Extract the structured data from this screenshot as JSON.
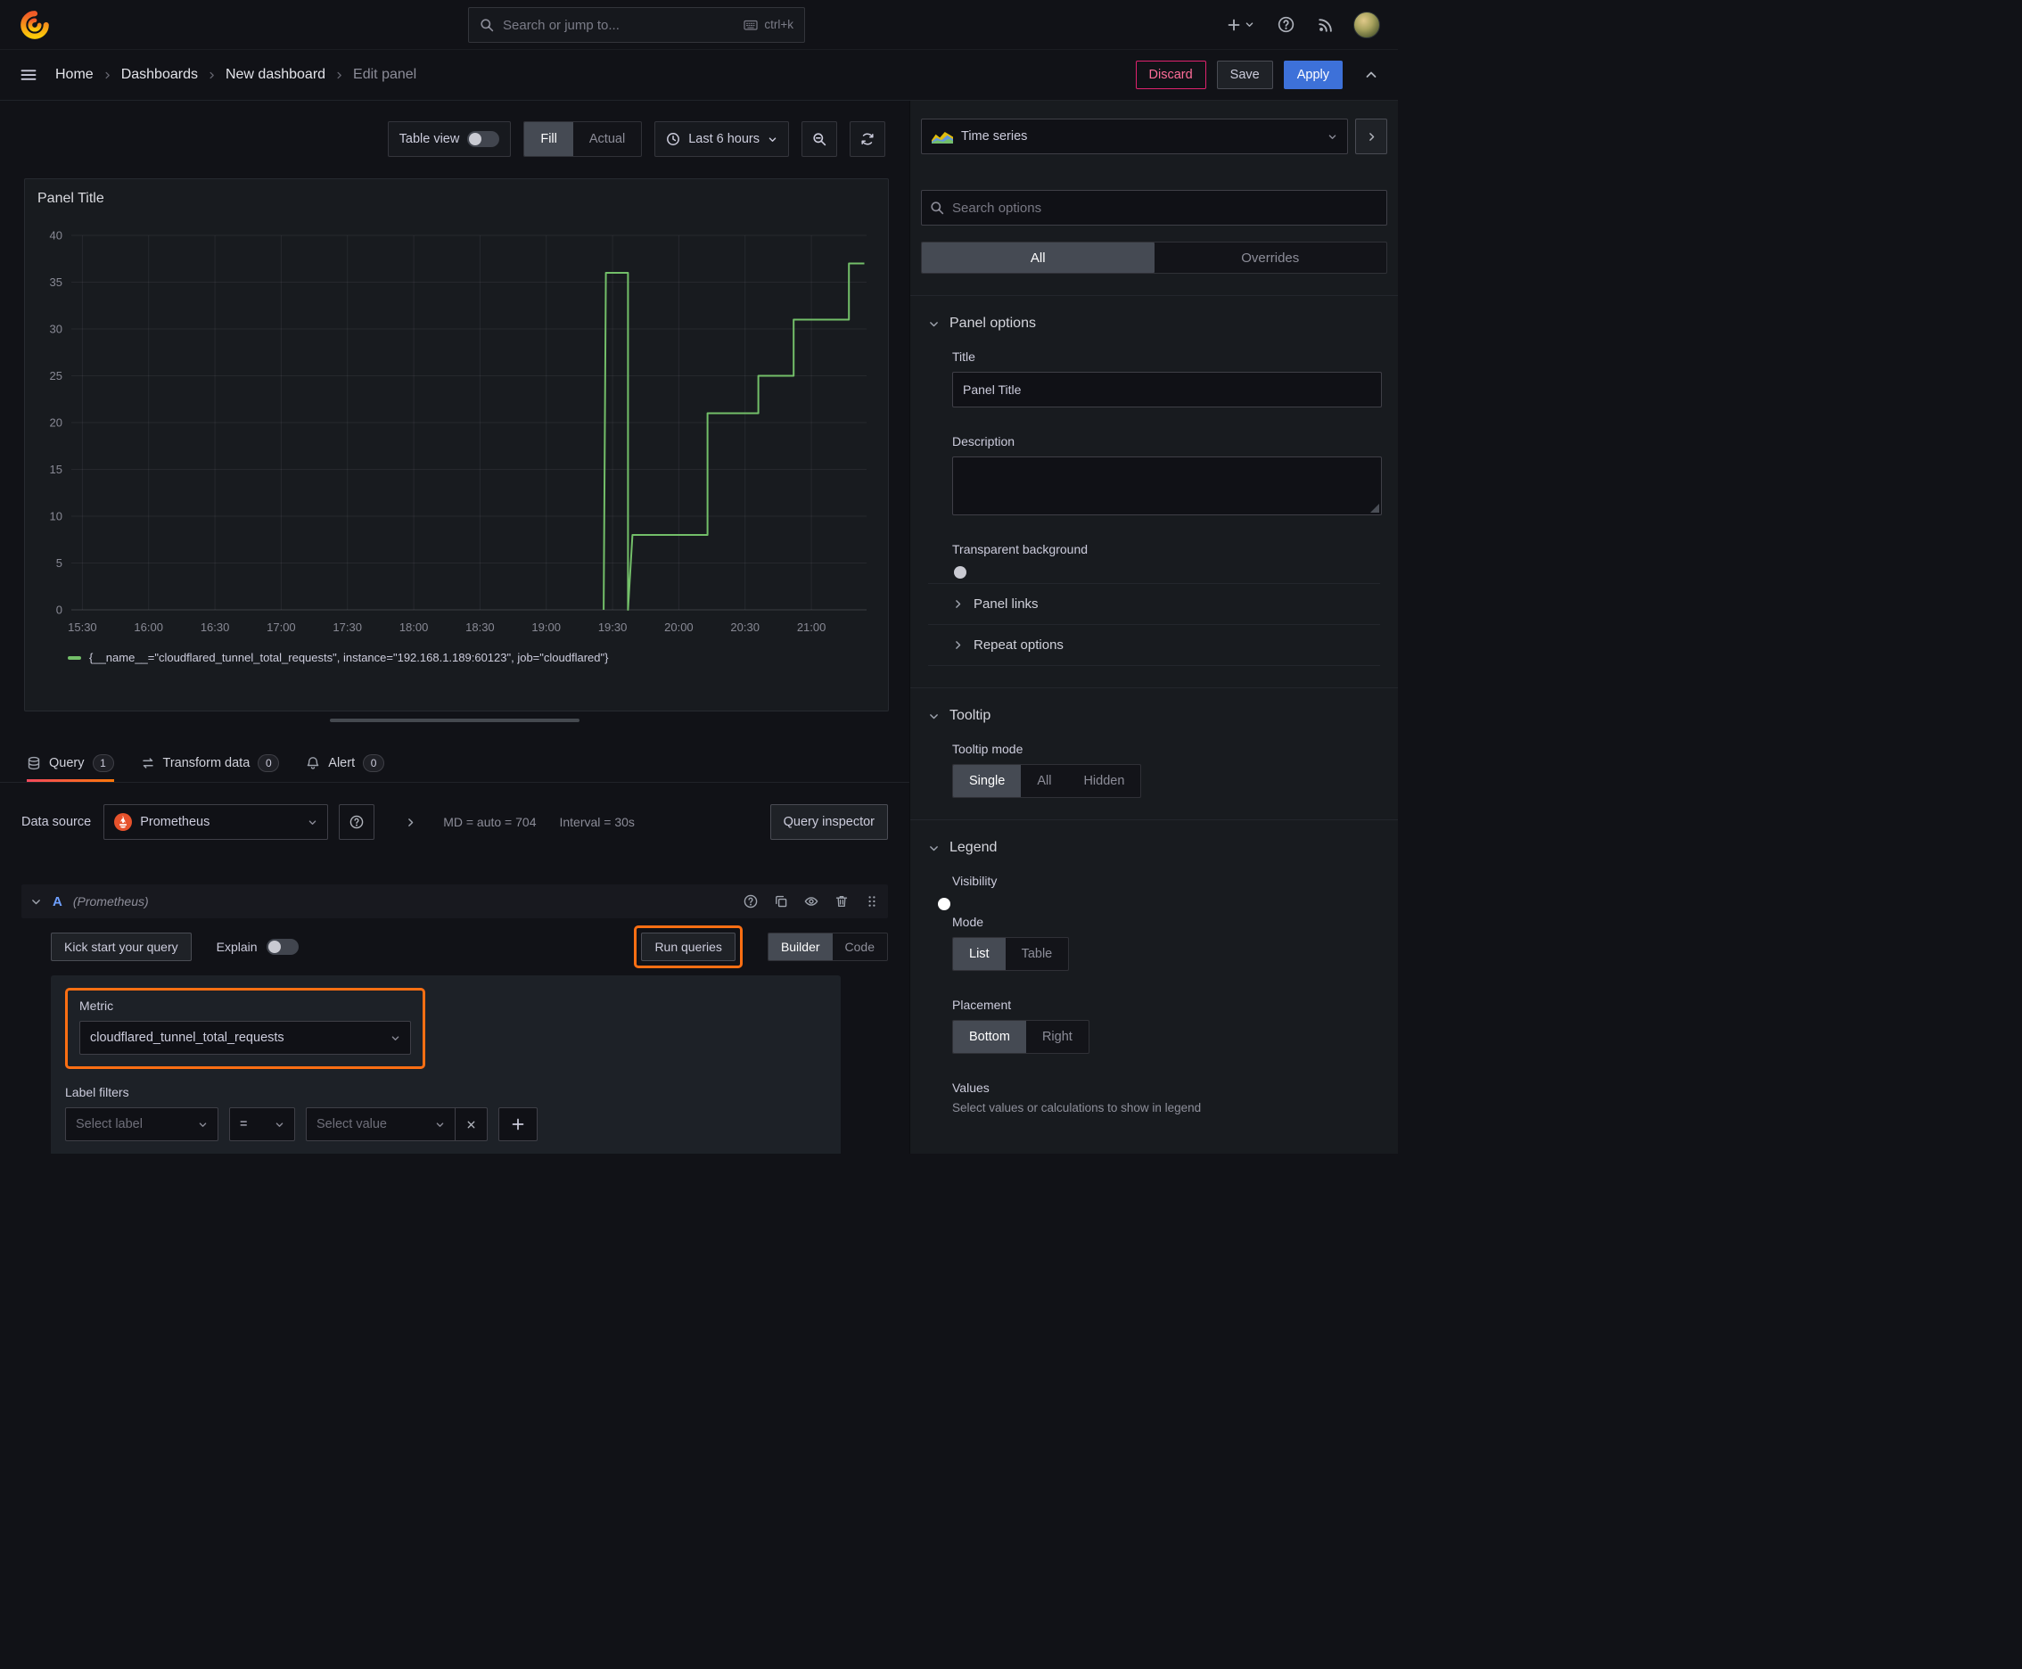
{
  "topnav": {
    "search_placeholder": "Search or jump to...",
    "search_shortcut": "ctrl+k"
  },
  "breadcrumbs": {
    "items": [
      "Home",
      "Dashboards",
      "New dashboard",
      "Edit panel"
    ]
  },
  "actions": {
    "discard": "Discard",
    "save": "Save",
    "apply": "Apply"
  },
  "toolbar": {
    "table_view": "Table view",
    "fill": "Fill",
    "actual": "Actual",
    "time_range": "Last 6 hours"
  },
  "panel": {
    "title": "Panel Title"
  },
  "chart_data": {
    "type": "line",
    "line_style": "step",
    "color": "#73bf69",
    "title": "Panel Title",
    "grid": true,
    "legend_position": "bottom",
    "x_domain": [
      "15:25",
      "21:25"
    ],
    "x_ticks": [
      "15:30",
      "16:00",
      "16:30",
      "17:00",
      "17:30",
      "18:00",
      "18:30",
      "19:00",
      "19:30",
      "20:00",
      "20:30",
      "21:00"
    ],
    "y_ticks": [
      0,
      5,
      10,
      15,
      20,
      25,
      30,
      35,
      40
    ],
    "ylim": [
      0,
      40
    ],
    "series": [
      {
        "name": "{__name__=\"cloudflared_tunnel_total_requests\", instance=\"192.168.1.189:60123\", job=\"cloudflared\"}",
        "points": [
          [
            "19:26",
            0
          ],
          [
            "19:27",
            36
          ],
          [
            "19:37",
            36
          ],
          [
            "19:37",
            0
          ],
          [
            "19:39",
            8
          ],
          [
            "20:13",
            8
          ],
          [
            "20:13",
            21
          ],
          [
            "20:36",
            21
          ],
          [
            "20:36",
            25
          ],
          [
            "20:52",
            25
          ],
          [
            "20:52",
            31
          ],
          [
            "21:17",
            31
          ],
          [
            "21:17",
            37
          ],
          [
            "21:24",
            37
          ]
        ]
      }
    ]
  },
  "tabs": {
    "query": {
      "label": "Query",
      "count": "1"
    },
    "transform": {
      "label": "Transform data",
      "count": "0"
    },
    "alert": {
      "label": "Alert",
      "count": "0"
    }
  },
  "query": {
    "datasource_label": "Data source",
    "datasource": "Prometheus",
    "max_data_points": "MD = auto = 704",
    "interval": "Interval = 30s",
    "inspector": "Query inspector",
    "ref_id": "A",
    "ref_hint": "(Prometheus)",
    "kick_start": "Kick start your query",
    "explain": "Explain",
    "run_queries": "Run queries",
    "builder": "Builder",
    "code": "Code",
    "metric_label": "Metric",
    "metric_value": "cloudflared_tunnel_total_requests",
    "label_filters": "Label filters",
    "select_label": "Select label",
    "operator": "=",
    "select_value": "Select value"
  },
  "options": {
    "viz": "Time series",
    "search_placeholder": "Search options",
    "tab_all": "All",
    "tab_overrides": "Overrides",
    "panel_options": {
      "heading": "Panel options",
      "title_label": "Title",
      "title_value": "Panel Title",
      "description_label": "Description",
      "transparent_label": "Transparent background",
      "panel_links": "Panel links",
      "repeat_options": "Repeat options"
    },
    "tooltip": {
      "heading": "Tooltip",
      "mode_label": "Tooltip mode",
      "modes": [
        "Single",
        "All",
        "Hidden"
      ],
      "selected_mode": "Single"
    },
    "legend": {
      "heading": "Legend",
      "visibility_label": "Visibility",
      "mode_label": "Mode",
      "modes": [
        "List",
        "Table"
      ],
      "selected_mode": "List",
      "placement_label": "Placement",
      "placements": [
        "Bottom",
        "Right"
      ],
      "selected_placement": "Bottom",
      "values_label": "Values",
      "values_help": "Select values or calculations to show in legend"
    }
  },
  "accent_colors": {
    "highlight_orange": "#ff6f13",
    "apply_blue": "#3d71d9",
    "series_green": "#73bf69",
    "discard_pink": "#e0226e"
  }
}
